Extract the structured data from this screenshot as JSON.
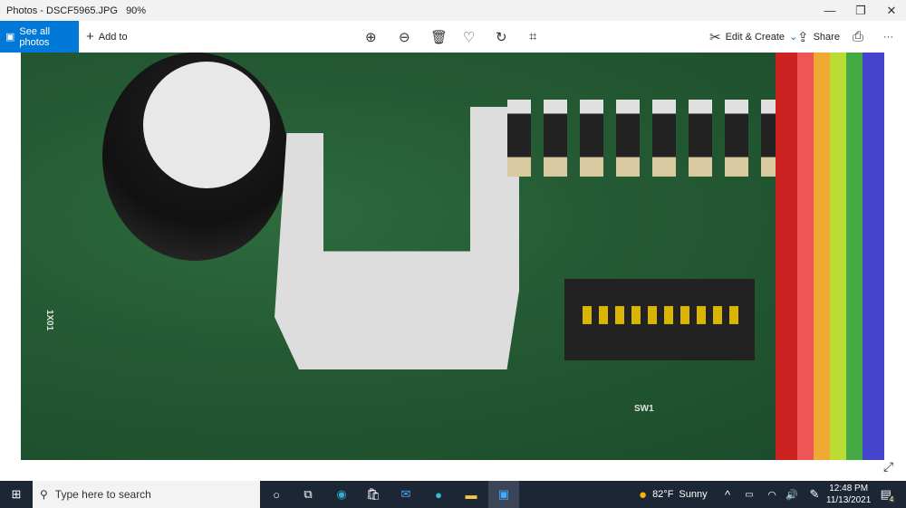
{
  "window": {
    "title": "Photos - DSCF5965.JPG",
    "zoom": "90%"
  },
  "toolbar": {
    "see_all": "See all photos",
    "add_to": "Add to",
    "edit_create": "Edit & Create",
    "share": "Share"
  },
  "photo": {
    "labels": {
      "sw": "SW1",
      "ixo": "1X01"
    }
  },
  "taskbar": {
    "search_placeholder": "Type here to search",
    "weather_temp": "82°F",
    "weather_cond": "Sunny",
    "time": "12:48 PM",
    "date": "11/13/2021",
    "notifications": "4"
  }
}
